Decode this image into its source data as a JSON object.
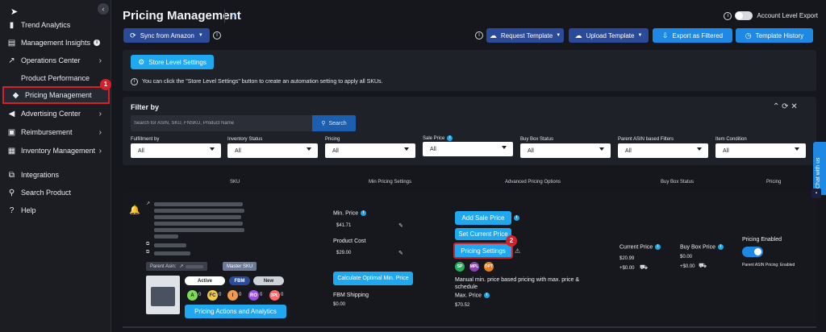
{
  "sidebar": {
    "items": [
      {
        "label": "Trend Analytics",
        "icon": "bar-chart-icon"
      },
      {
        "label": "Management Insights",
        "icon": "insights-icon",
        "info": "i"
      },
      {
        "label": "Operations Center",
        "icon": "trend-up-icon",
        "chevron": "›"
      },
      {
        "label": "Product Performance",
        "icon": "blank-icon"
      },
      {
        "label": "Pricing Management",
        "icon": "tag-icon",
        "active": true,
        "step_badge": "1"
      },
      {
        "label": "Advertising Center",
        "icon": "megaphone-icon",
        "chevron": "›"
      },
      {
        "label": "Reimbursement",
        "icon": "money-icon",
        "chevron": "›"
      },
      {
        "label": "Inventory Management",
        "icon": "box-icon",
        "chevron": "›"
      },
      {
        "label": "Integrations",
        "icon": "plug-icon"
      },
      {
        "label": "Search Product",
        "icon": "search-icon"
      },
      {
        "label": "Help",
        "icon": "help-icon"
      }
    ],
    "collapse_glyph": "‹"
  },
  "header": {
    "title": "Pricing Management",
    "account_export_label": "Account Level Export",
    "sync_button": "Sync from Amazon",
    "request_template": "Request Template",
    "upload_template": "Upload Template",
    "export_filtered": "Export as Filtered",
    "template_history": "Template History"
  },
  "store": {
    "button": "Store Level Settings",
    "notice": "You can click the \"Store Level Settings\" button to create an automation setting to apply all SKUs."
  },
  "filter": {
    "title": "Filter by",
    "search_placeholder": "Search for ASIN, SKU, FNSKU, Product Name",
    "search_button": "Search",
    "controls": "⌃ ⟳ ✕",
    "fields": [
      {
        "label": "Fulfillment by",
        "value": "All"
      },
      {
        "label": "Inventory Status",
        "value": "All"
      },
      {
        "label": "Pricing",
        "value": "All"
      },
      {
        "label": "Sale Price",
        "value": "All"
      },
      {
        "label": "Buy Box Status",
        "value": "All"
      },
      {
        "label": "Parent ASIN based Filters",
        "value": "All"
      },
      {
        "label": "Item Condition",
        "value": "All"
      }
    ]
  },
  "table": {
    "headers": [
      "SKU",
      "Min Pricing Settings",
      "Advanced Pricing Options",
      "Buy Box Status",
      "Pricing"
    ]
  },
  "row": {
    "parent_asin_label": "Parent Asin:",
    "master_sku": "Master SKU",
    "status_active": "Active",
    "status_fbm": "FBM",
    "status_new": "New",
    "badges": [
      {
        "letter": "A",
        "count": "0",
        "color": "#7ed957"
      },
      {
        "letter": "FC",
        "count": "0",
        "color": "#f2c94c"
      },
      {
        "letter": "I",
        "count": "0",
        "color": "#f2994a"
      },
      {
        "letter": "RO",
        "count": "0",
        "color": "#9b51e0"
      },
      {
        "letter": "3PL",
        "count": "0",
        "color": "#ff6b6b"
      }
    ],
    "pricing_actions": "Pricing Actions and Analytics",
    "min_price_label": "Min. Price",
    "min_price_value": "$41.71",
    "product_cost_label": "Product Cost",
    "product_cost_value": "$29.00",
    "calc_button": "Calculate Optimal Min. Price",
    "fbm_shipping_label": "FBM Shipping",
    "fbm_shipping_value": "$0.00",
    "add_sale_price": "Add Sale Price",
    "set_current_price": "Set Current Price",
    "pricing_settings": "Pricing Settings",
    "step_badge": "2",
    "tags": [
      {
        "label": "SP",
        "color": "#27ae60"
      },
      {
        "label": "MPL",
        "color": "#8e44ad"
      },
      {
        "label": "DPT",
        "color": "#e67e22"
      }
    ],
    "strategy_text": "Manual min. price based pricing with max. price & schedule",
    "max_price_label": "Max. Price",
    "max_price_value": "$70.52",
    "current_price_label": "Current Price",
    "current_price_value": "$20.99",
    "current_shipping": "+$0.00",
    "buybox_price_label": "Buy Box Price",
    "buybox_price_value": "$0.00",
    "buybox_shipping": "+$0.00",
    "pricing_enabled_label": "Pricing Enabled",
    "parent_asin_pricing": "Parent ASIN Pricing: Enabled"
  },
  "chat": {
    "label": "Chat with us"
  }
}
